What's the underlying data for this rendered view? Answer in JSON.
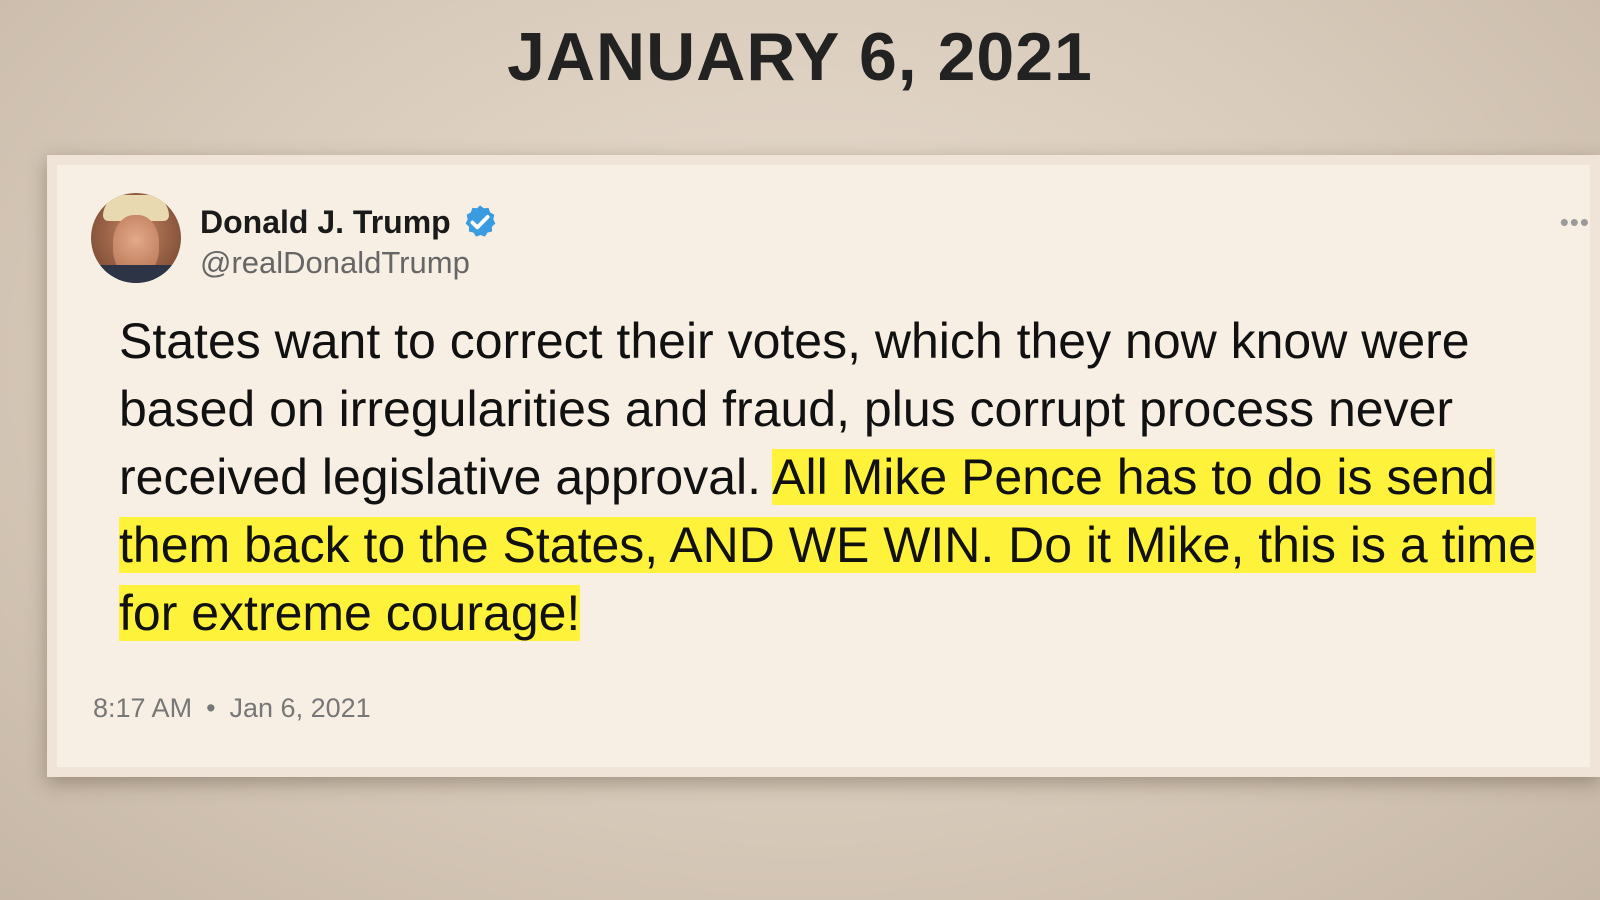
{
  "heading": "JANUARY 6, 2021",
  "tweet": {
    "display_name": "Donald J. Trump",
    "handle": "@realDonaldTrump",
    "text_plain": "States want to correct their votes, which they now know were based on irregularities and fraud, plus corrupt process never received legislative approval. ",
    "text_highlighted": "All Mike Pence has to do is send them back to the States, AND WE WIN. Do it Mike, this is a time for extreme courage!",
    "time": "8:17 AM",
    "separator": "•",
    "date": "Jan 6, 2021",
    "more_menu": "•••",
    "verified_icon": "verified-badge-icon"
  },
  "colors": {
    "highlight": "#fff23a",
    "verified": "#3a9be0",
    "background": "#d9cbbb",
    "card": "#f7efe4"
  }
}
